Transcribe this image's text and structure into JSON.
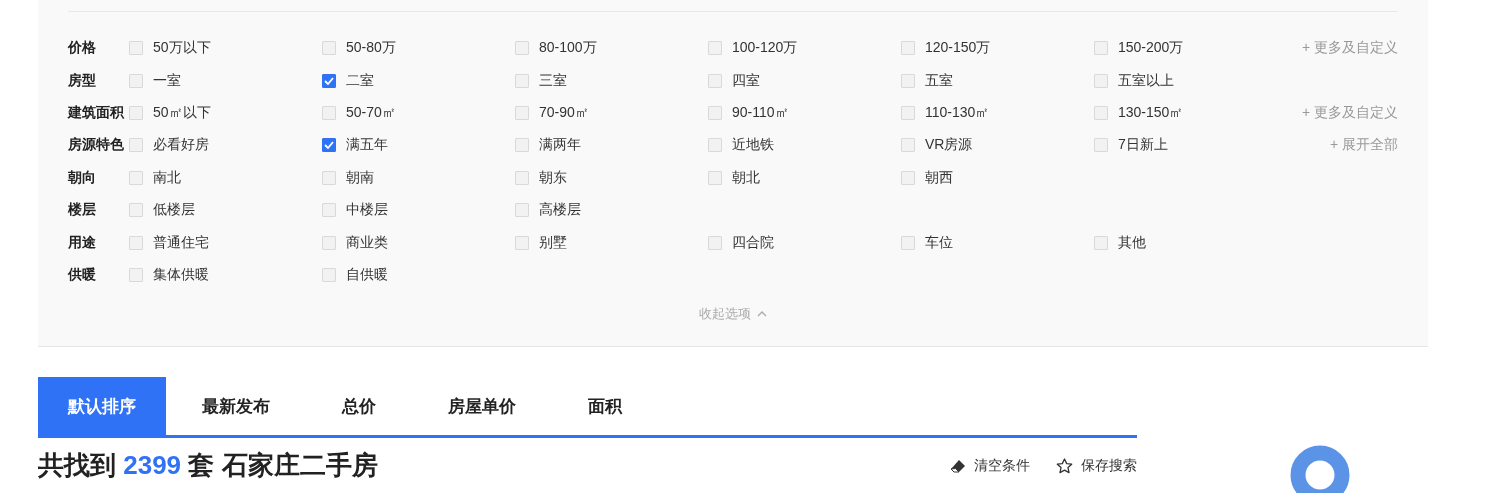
{
  "filters": [
    {
      "label": "价格",
      "options": [
        {
          "label": "50万以下",
          "checked": false
        },
        {
          "label": "50-80万",
          "checked": false
        },
        {
          "label": "80-100万",
          "checked": false
        },
        {
          "label": "100-120万",
          "checked": false
        },
        {
          "label": "120-150万",
          "checked": false
        },
        {
          "label": "150-200万",
          "checked": false
        }
      ],
      "more": "+ 更多及自定义"
    },
    {
      "label": "房型",
      "options": [
        {
          "label": "一室",
          "checked": false
        },
        {
          "label": "二室",
          "checked": true
        },
        {
          "label": "三室",
          "checked": false
        },
        {
          "label": "四室",
          "checked": false
        },
        {
          "label": "五室",
          "checked": false
        },
        {
          "label": "五室以上",
          "checked": false
        }
      ]
    },
    {
      "label": "建筑面积",
      "options": [
        {
          "label": "50㎡以下",
          "checked": false
        },
        {
          "label": "50-70㎡",
          "checked": false
        },
        {
          "label": "70-90㎡",
          "checked": false
        },
        {
          "label": "90-110㎡",
          "checked": false
        },
        {
          "label": "110-130㎡",
          "checked": false
        },
        {
          "label": "130-150㎡",
          "checked": false
        }
      ],
      "more": "+ 更多及自定义"
    },
    {
      "label": "房源特色",
      "options": [
        {
          "label": "必看好房",
          "checked": false
        },
        {
          "label": "满五年",
          "checked": true
        },
        {
          "label": "满两年",
          "checked": false
        },
        {
          "label": "近地铁",
          "checked": false
        },
        {
          "label": "VR房源",
          "checked": false
        },
        {
          "label": "7日新上",
          "checked": false
        }
      ],
      "more": "+ 展开全部"
    },
    {
      "label": "朝向",
      "options": [
        {
          "label": "南北",
          "checked": false
        },
        {
          "label": "朝南",
          "checked": false
        },
        {
          "label": "朝东",
          "checked": false
        },
        {
          "label": "朝北",
          "checked": false
        },
        {
          "label": "朝西",
          "checked": false
        }
      ]
    },
    {
      "label": "楼层",
      "options": [
        {
          "label": "低楼层",
          "checked": false
        },
        {
          "label": "中楼层",
          "checked": false
        },
        {
          "label": "高楼层",
          "checked": false
        }
      ]
    },
    {
      "label": "用途",
      "options": [
        {
          "label": "普通住宅",
          "checked": false
        },
        {
          "label": "商业类",
          "checked": false
        },
        {
          "label": "别墅",
          "checked": false
        },
        {
          "label": "四合院",
          "checked": false
        },
        {
          "label": "车位",
          "checked": false
        },
        {
          "label": "其他",
          "checked": false
        }
      ]
    },
    {
      "label": "供暖",
      "options": [
        {
          "label": "集体供暖",
          "checked": false
        },
        {
          "label": "自供暖",
          "checked": false
        }
      ]
    }
  ],
  "collapse": "收起选项",
  "sort_tabs": [
    {
      "label": "默认排序",
      "selected": true
    },
    {
      "label": "最新发布",
      "selected": false
    },
    {
      "label": "总价",
      "selected": false
    },
    {
      "label": "房屋单价",
      "selected": false
    },
    {
      "label": "面积",
      "selected": false
    }
  ],
  "result": {
    "prefix": "共找到",
    "count": "2399",
    "suffix": "套 石家庄二手房"
  },
  "actions": [
    {
      "kind": "eraser",
      "label": "清空条件"
    },
    {
      "kind": "star",
      "label": "保存搜索"
    }
  ]
}
